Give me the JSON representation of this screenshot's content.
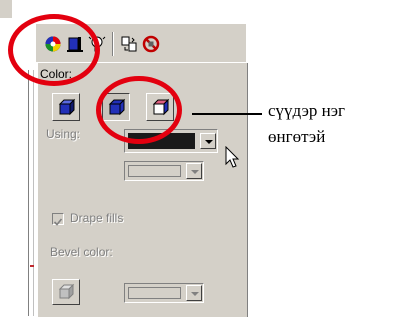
{
  "panel": {
    "color_label": "Color:",
    "using_label": "Using:",
    "drape_fills_label": "Drape fills",
    "drape_fills_checked": true,
    "bevel_color_label": "Bevel color:",
    "using_color": "#1a1a1a"
  },
  "toolbar": {
    "icons": [
      "color-wheel-icon",
      "fill-bucket-icon",
      "light-bulb-icon",
      "copy-attributes-icon",
      "no-entry-icon"
    ]
  },
  "annotation": {
    "line1": "сүүдэр нэг",
    "line2": "өнгөтэй"
  },
  "colors": {
    "highlight": "#e3000f",
    "panel_bg": "#d4d0c8",
    "extrude_blue": "#2230b8"
  }
}
